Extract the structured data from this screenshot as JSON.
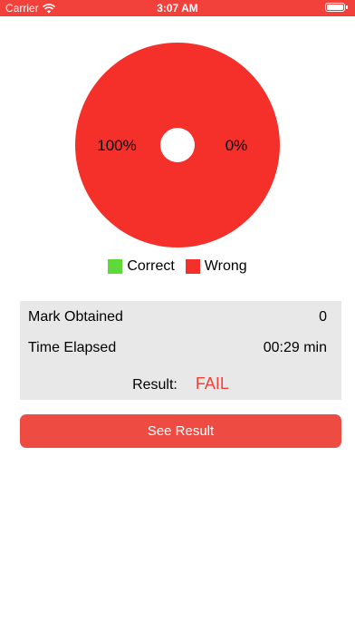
{
  "status_bar": {
    "carrier": "Carrier",
    "time": "3:07 AM"
  },
  "chart_data": {
    "type": "pie",
    "categories": [
      "Correct",
      "Wrong"
    ],
    "values": [
      0,
      100
    ],
    "labels": [
      "0%",
      "100%"
    ],
    "colors": [
      "#5fd93a",
      "#f5302b"
    ]
  },
  "legend": [
    {
      "label": "Correct",
      "color": "#5fd93a"
    },
    {
      "label": "Wrong",
      "color": "#f5302b"
    }
  ],
  "summary": {
    "mark_label": "Mark Obtained",
    "mark_value": "0",
    "time_label": "Time Elapsed",
    "time_value": "00:29 min",
    "result_label": "Result:",
    "result_value": "FAIL"
  },
  "button": {
    "label": "See Result"
  },
  "colors": {
    "accent": "#f2403b",
    "panel": "#e8e8e8"
  }
}
